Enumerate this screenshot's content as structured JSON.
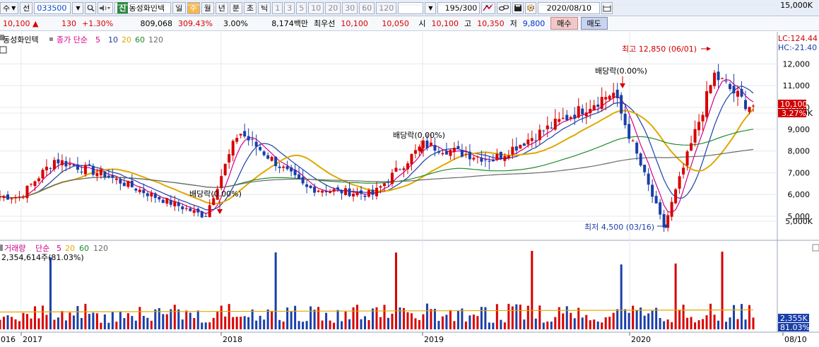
{
  "toolbar": {
    "type_label": "주",
    "prev_label": "전",
    "code": "033500",
    "shin_label": "신",
    "stock_name": "동성화인텍",
    "periods": [
      "일",
      "주",
      "월",
      "년",
      "분",
      "초",
      "틱"
    ],
    "selected_period": "주",
    "intervals": [
      "1",
      "3",
      "5",
      "10",
      "20",
      "30",
      "60",
      "120"
    ],
    "bar_count": "195",
    "bar_total": "/300",
    "date": "2020/08/10"
  },
  "quote": {
    "price": "10,100",
    "change_arrow": "▲",
    "change": "130",
    "change_pct": "+1.30%",
    "volume": "809,068",
    "volume_pct": "309.43%",
    "turnover": "3.00%",
    "amount": "8,174백만",
    "best_ask_label": "최우선",
    "best_ask": "10,100",
    "best_bid": "10,050",
    "open_label": "시",
    "open": "10,100",
    "high_label": "고",
    "high": "10,350",
    "low_label": "저",
    "low": "9,800",
    "buy_label": "매수",
    "sell_label": "매도"
  },
  "price_panel": {
    "legend_name": "동성화인텍",
    "legend_ma_label": "종가 단순",
    "ma_periods": [
      "5",
      "10",
      "20",
      "60",
      "120"
    ],
    "ma_colors": [
      "#d0008c",
      "#1a3fa8",
      "#e0a800",
      "#1f8c2c",
      "#6b6b6b"
    ],
    "lc_label": "LC:124.44",
    "hc_label": "HC:-21.40",
    "high_annotation": "최고 12,850 (06/01)",
    "low_annotation": "최저 4,500 (03/16)",
    "dividend_annotations": [
      "배당락(0.00%)",
      "배당락(0.00%)",
      "배당락(0.00%)"
    ],
    "current_price_tag": "10,100",
    "current_pct_tag": "3.27%"
  },
  "volume_panel": {
    "legend_label": "거래량",
    "legend_ma_label": "단순",
    "ma_periods": [
      "5",
      "20",
      "60",
      "120"
    ],
    "ma_colors": [
      "#d0008c",
      "#e0a800",
      "#1f8c2c",
      "#6b6b6b"
    ],
    "volume_info": "2,354,614주(81.03%)",
    "current_volume_tag": "2,355K",
    "current_pct_tag": "81.03%"
  },
  "chart_data": [
    {
      "type": "candlestick",
      "title": "동성화인텍",
      "y_axis_ticks": [
        5000,
        6000,
        7000,
        8000,
        9000,
        10000,
        11000,
        12000
      ],
      "y_tick_labels": [
        "5,000",
        "6,000",
        "7,000",
        "8,000",
        "9,000",
        "10,000",
        "11,000",
        "12,000"
      ],
      "ylim": [
        4000,
        13300
      ],
      "x_axis_labels": [
        "2016",
        "2017",
        "2018",
        "2019",
        "2020",
        "08/10"
      ],
      "approx_trend": [
        {
          "date": "2016-12",
          "price": 5900
        },
        {
          "date": "2017-03",
          "price": 7600
        },
        {
          "date": "2017-06",
          "price": 6900
        },
        {
          "date": "2017-09",
          "price": 5900
        },
        {
          "date": "2017-12",
          "price": 5000
        },
        {
          "date": "2018-02",
          "price": 8900
        },
        {
          "date": "2018-06",
          "price": 6300
        },
        {
          "date": "2018-10",
          "price": 6000
        },
        {
          "date": "2019-01",
          "price": 8300
        },
        {
          "date": "2019-05",
          "price": 7600
        },
        {
          "date": "2019-09",
          "price": 9400
        },
        {
          "date": "2019-12",
          "price": 10700
        },
        {
          "date": "2020-03",
          "price": 4500
        },
        {
          "date": "2020-06",
          "price": 11500
        },
        {
          "date": "2020-08",
          "price": 10100
        }
      ],
      "high": {
        "value": 12850,
        "date": "06/01"
      },
      "low": {
        "value": 4500,
        "date": "03/16"
      },
      "legend": "top-left"
    },
    {
      "type": "bar",
      "title": "거래량",
      "y_axis_ticks": [
        5000,
        10000,
        15000
      ],
      "y_tick_labels": [
        "5,000K",
        "10,000K",
        "15,000K"
      ],
      "unit": "K",
      "current_volume": 2355
    }
  ]
}
